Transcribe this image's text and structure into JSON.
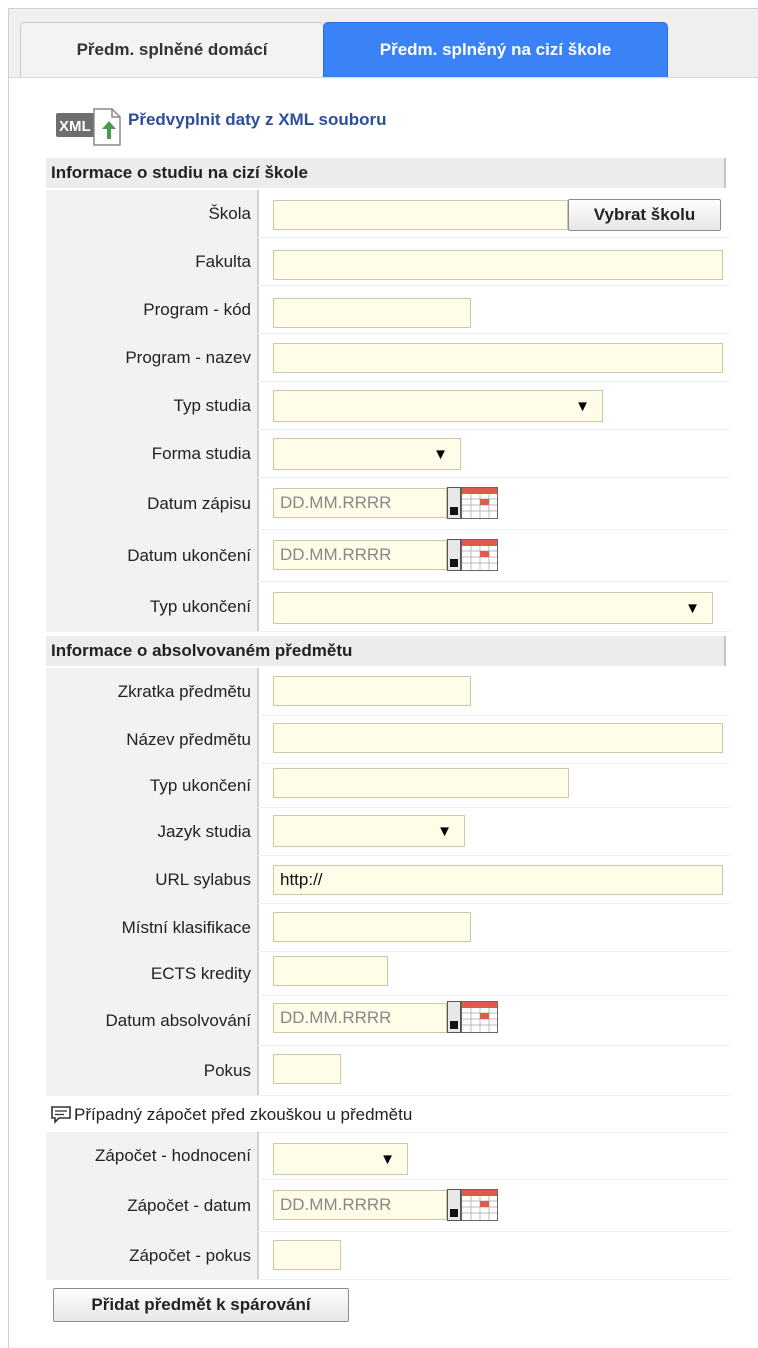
{
  "tabs": [
    {
      "label": "Předm. splněné domácí",
      "active": false
    },
    {
      "label": "Předm. splněný na cizí škole",
      "active": true
    }
  ],
  "xml_import": {
    "label": "Předvyplnit daty z XML souboru",
    "icon": "xml-upload-icon"
  },
  "section_study": {
    "title": "Informace o studiu na cizí škole"
  },
  "study": {
    "school_label": "Škola",
    "school_value": "",
    "choose_school_button": "Vybrat školu",
    "faculty_label": "Fakulta",
    "faculty_value": "",
    "program_code_label": "Program - kód",
    "program_code_value": "",
    "program_name_label": "Program - nazev",
    "program_name_value": "",
    "study_type_label": "Typ studia",
    "study_type_value": "",
    "study_form_label": "Forma studia",
    "study_form_value": "",
    "enroll_date_label": "Datum zápisu",
    "enroll_date_placeholder": "DD.MM.RRRR",
    "end_date_label": "Datum ukončení",
    "end_date_placeholder": "DD.MM.RRRR",
    "end_type_label": "Typ ukončení",
    "end_type_value": ""
  },
  "section_course": {
    "title": "Informace o absolvovaném předmětu"
  },
  "course": {
    "abbr_label": "Zkratka předmětu",
    "abbr_value": "",
    "name_label": "Název předmětu",
    "name_value": "",
    "end_type_label": "Typ ukončení",
    "end_type_value": "",
    "language_label": "Jazyk studia",
    "language_value": "",
    "syllabus_url_label": "URL sylabus",
    "syllabus_url_value": "http://",
    "local_grade_label": "Místní klasifikace",
    "local_grade_value": "",
    "ects_label": "ECTS kredity",
    "ects_value": "",
    "completion_date_label": "Datum absolvování",
    "completion_date_placeholder": "DD.MM.RRRR",
    "attempt_label": "Pokus",
    "attempt_value": ""
  },
  "credit_note": {
    "text": "Případný zápočet před zkouškou u předmětu",
    "icon": "comment-icon"
  },
  "credit": {
    "grade_label": "Zápočet - hodnocení",
    "grade_value": "",
    "date_label": "Zápočet - datum",
    "date_placeholder": "DD.MM.RRRR",
    "attempt_label": "Zápočet - pokus",
    "attempt_value": ""
  },
  "submit_button": "Přidat předmět k spárování",
  "colors": {
    "active_tab": "#3a82f6",
    "input_bg": "#fffde8",
    "link": "#2b4ea0",
    "label_bg": "#f2f2f2"
  }
}
